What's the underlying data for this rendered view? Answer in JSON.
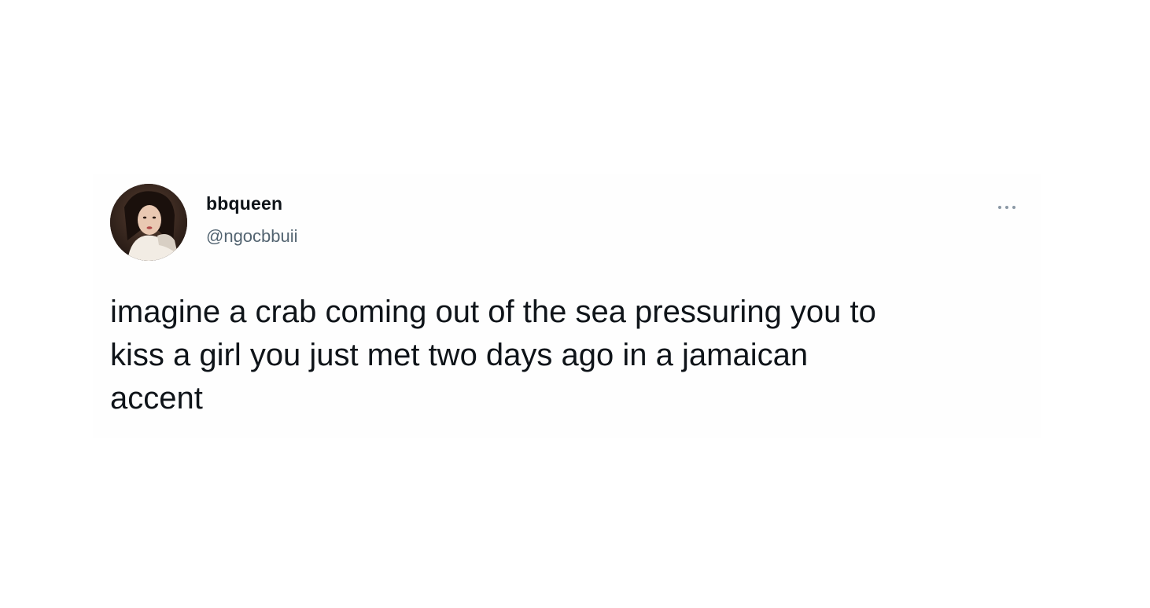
{
  "tweet": {
    "author": {
      "display_name": "bbqueen",
      "handle": "@ngocbbuii",
      "avatar_icon": "profile-photo"
    },
    "more_icon": "more-options-icon",
    "text": "imagine a crab coming out of the sea pressuring you to\nkiss a girl you just met two days ago in a jamaican\naccent"
  },
  "colors": {
    "text_primary": "#0f1419",
    "text_secondary": "#536471",
    "background": "#ffffff"
  }
}
